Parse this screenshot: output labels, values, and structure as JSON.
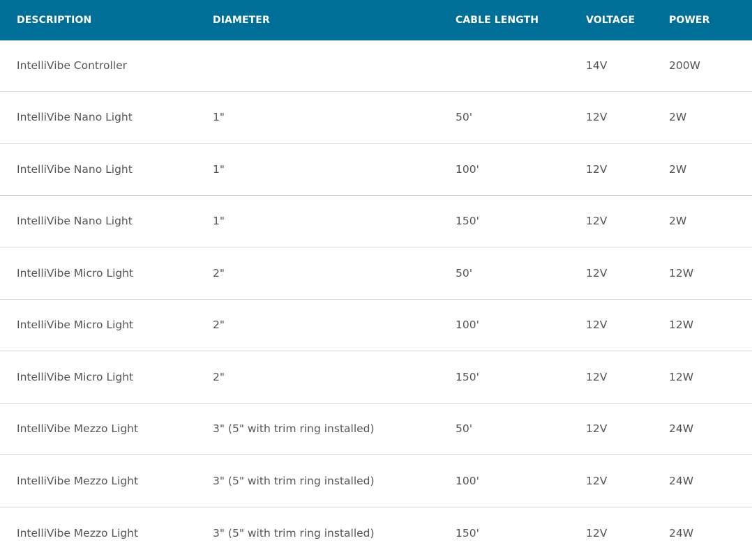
{
  "table": {
    "headers": [
      "DESCRIPTION",
      "DIAMETER",
      "CABLE LENGTH",
      "VOLTAGE",
      "POWER"
    ],
    "rows": [
      [
        "IntelliVibe Controller",
        "",
        "",
        "14V",
        "200W"
      ],
      [
        "IntelliVibe Nano Light",
        "1\"",
        "50'",
        "12V",
        "2W"
      ],
      [
        "IntelliVibe Nano Light",
        "1\"",
        "100'",
        "12V",
        "2W"
      ],
      [
        "IntelliVibe Nano Light",
        "1\"",
        "150'",
        "12V",
        "2W"
      ],
      [
        "IntelliVibe Micro Light",
        "2\"",
        "50'",
        "12V",
        "12W"
      ],
      [
        "IntelliVibe Micro Light",
        "2\"",
        "100'",
        "12V",
        "12W"
      ],
      [
        "IntelliVibe Micro Light",
        "2\"",
        "150'",
        "12V",
        "12W"
      ],
      [
        "IntelliVibe Mezzo Light",
        "3\" (5\" with trim ring installed)",
        "50'",
        "12V",
        "24W"
      ],
      [
        "IntelliVibe Mezzo Light",
        "3\" (5\" with trim ring installed)",
        "100'",
        "12V",
        "24W"
      ],
      [
        "IntelliVibe Mezzo Light",
        "3\" (5\" with trim ring installed)",
        "150'",
        "12V",
        "24W"
      ]
    ]
  },
  "colors": {
    "header_background": "#006f98",
    "header_text": "#ffffff",
    "cell_text": "#555555",
    "row_divider": "#d4d4d4"
  }
}
